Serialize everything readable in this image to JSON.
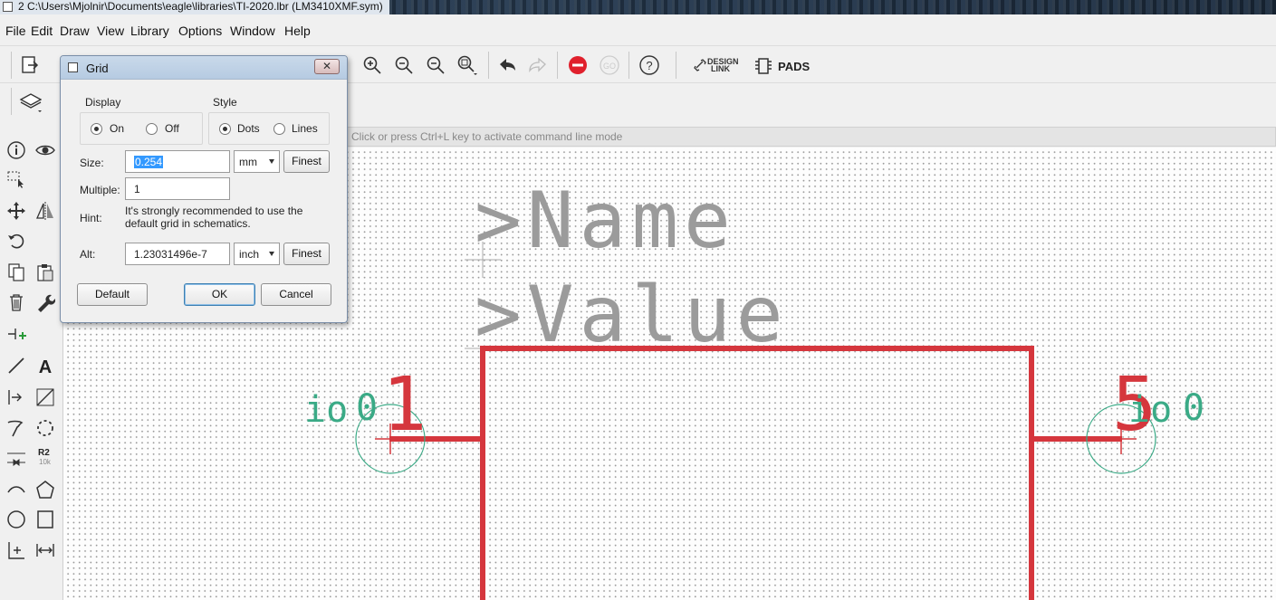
{
  "window": {
    "title": "2 C:\\Users\\Mjolnir\\Documents\\eagle\\libraries\\TI-2020.lbr (LM3410XMF.sym)"
  },
  "menu": [
    "File",
    "Edit",
    "Draw",
    "View",
    "Library",
    "Options",
    "Window",
    "Help"
  ],
  "toolbar": {
    "design_link": "DESIGN\nLINK",
    "design_link_1": "DESIGN",
    "design_link_2": "LINK",
    "pads": "PADS"
  },
  "command_line": {
    "placeholder": "Click or press Ctrl+L key to activate command line mode"
  },
  "grid_dialog": {
    "title": "Grid",
    "display_label": "Display",
    "style_label": "Style",
    "display_on": "On",
    "display_off": "Off",
    "display_value": "On",
    "style_dots": "Dots",
    "style_lines": "Lines",
    "style_value": "Dots",
    "size_label": "Size:",
    "size_value": "0.254",
    "size_unit": "mm",
    "multiple_label": "Multiple:",
    "multiple_value": "1",
    "hint_label": "Hint:",
    "hint_line1": "It's strongly recommended to use the",
    "hint_line2": "default grid in schematics.",
    "alt_label": "Alt:",
    "alt_value": "1.23031496e-7",
    "alt_unit": "inch",
    "finest_label": "Finest",
    "default_button": "Default",
    "ok_button": "OK",
    "cancel_button": "Cancel"
  },
  "symbol": {
    "name_text": ">Name",
    "value_text": ">Value",
    "pin_left_name": "io",
    "pin_left_number": "1",
    "pin_left_zero": "0",
    "pin_right_name": "io",
    "pin_right_number": "5",
    "pin_right_zero": "0",
    "r2_label": "R2",
    "r2_value": "10k"
  },
  "colors": {
    "symbol_outline": "#d5363d",
    "pin_text": "#3aaa86",
    "placeholder_text": "#9b9b9b",
    "stop_icon": "#e0202c"
  }
}
